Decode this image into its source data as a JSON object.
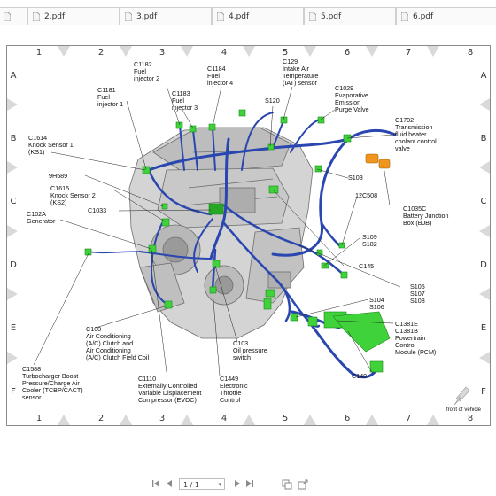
{
  "tabs": [
    {
      "label": "",
      "icon": "pdf-file-icon"
    },
    {
      "label": "2.pdf",
      "icon": "pdf-file-icon"
    },
    {
      "label": "3.pdf",
      "icon": "pdf-file-icon"
    },
    {
      "label": "4.pdf",
      "icon": "pdf-file-icon"
    },
    {
      "label": "5.pdf",
      "icon": "pdf-file-icon"
    },
    {
      "label": "6.pdf",
      "icon": "pdf-file-icon"
    }
  ],
  "grid": {
    "columns": [
      "1",
      "2",
      "3",
      "4",
      "5",
      "6",
      "7",
      "8"
    ],
    "rows": [
      "A",
      "B",
      "C",
      "D",
      "E",
      "F"
    ]
  },
  "labels": {
    "c1182": "C1182\nFuel\ninjector 2",
    "c1184": "C1184\nFuel\ninjector 4",
    "c129": "C129\nIntake Air\nTemperature\n(IAT) sensor",
    "c1181": "C1181\nFuel\ninjector 1",
    "c1183": "C1183\nFuel\ninjector 3",
    "c1029": "C1029\nEvaporative\nEmission\nPurge Valve",
    "s120": "S120",
    "c1614": "C1614\nKnock Sensor 1\n(KS1)",
    "c1702": "C1702\nTransmission\nfluid heater\ncoolant control\nvalve",
    "9h589": "9H589",
    "s103": "S103",
    "c1615": "C1615\nKnock Sensor 2\n(KS2)",
    "12c508": "12C508",
    "c1033": "C1033",
    "c102a": "C102A\nGenerator",
    "c1035c": "C1035C\nBattery Junction\nBox (BJB)",
    "s109": "S109\nS182",
    "c145": "C145",
    "s105": "S105\nS107\nS108",
    "s104": "S104\nS106",
    "c1381e": "C1381E\nC1381B\nPowertrain\nControl\nModule (PCM)",
    "c100": "C100\nAir Conditioning\n(A/C) Clutch and\nAir Conditioning\n(A/C) Clutch Field Coil",
    "c103": "C103\nOil pressure\nswitch",
    "c140": "C140",
    "c1588": "C1588\nTurbocharger Boost\nPressure/Charge Air\nCooler (TCBP/CACT)\nsensor",
    "c1110": "C1110\nExternally Controlled\nVariable Displacement\nCompressor (EVDC)",
    "c1449": "C1449\nElectronic\nThrottle\nControl",
    "front": "front of vehicle"
  },
  "toolbar": {
    "page_indicator": "1 / 1",
    "icons": [
      "first-page-icon",
      "previous-page-icon",
      "next-page-icon",
      "last-page-icon",
      "copy-icon",
      "share-icon"
    ]
  },
  "colors": {
    "harness": "#2a46b0",
    "connector": "#3fd23a",
    "orange_connector": "#f0961e",
    "engine": "#8c8c8c"
  }
}
